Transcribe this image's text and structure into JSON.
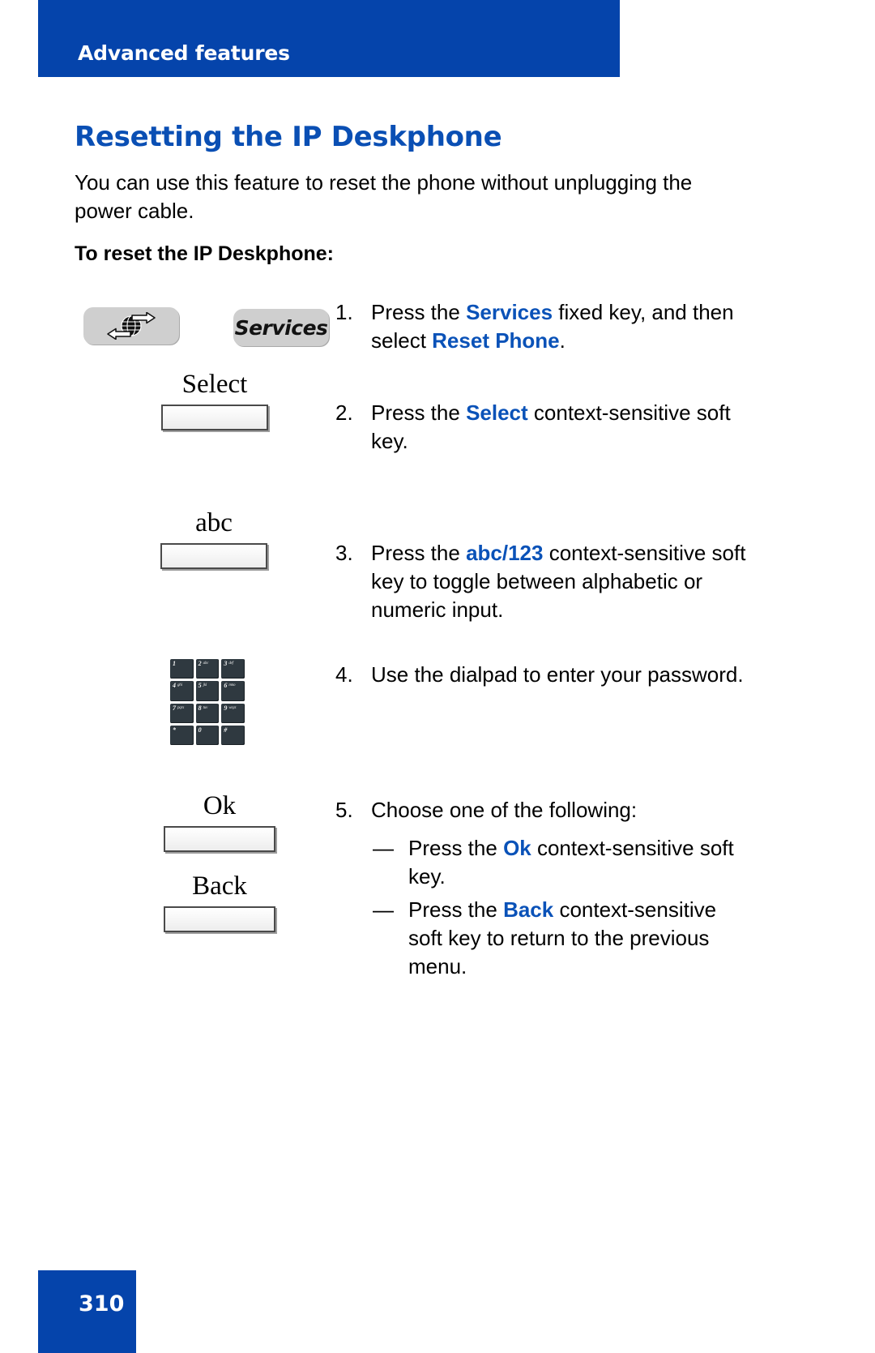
{
  "header": {
    "running_title": "Advanced features"
  },
  "page": {
    "heading": "Resetting the IP Deskphone",
    "intro": "You can use this feature to reset the phone without unplugging the power cable.",
    "subheading": "To reset the IP Deskphone:",
    "page_number": "310"
  },
  "keys": {
    "globe_icon": "globe-arrows-icon",
    "services_label": "Services"
  },
  "softkeys": [
    {
      "id": "select",
      "label": "Select"
    },
    {
      "id": "abc",
      "label": "abc"
    },
    {
      "id": "ok",
      "label": "Ok"
    },
    {
      "id": "back",
      "label": "Back"
    }
  ],
  "dialpad": {
    "keys": [
      {
        "digit": "1",
        "letters": ""
      },
      {
        "digit": "2",
        "letters": "abc"
      },
      {
        "digit": "3",
        "letters": "def"
      },
      {
        "digit": "4",
        "letters": "ghi"
      },
      {
        "digit": "5",
        "letters": "jkl"
      },
      {
        "digit": "6",
        "letters": "mno"
      },
      {
        "digit": "7",
        "letters": "pqrs"
      },
      {
        "digit": "8",
        "letters": "tuv"
      },
      {
        "digit": "9",
        "letters": "wxyz"
      },
      {
        "digit": "*",
        "letters": ""
      },
      {
        "digit": "0",
        "letters": ""
      },
      {
        "digit": "#",
        "letters": ""
      }
    ]
  },
  "steps": {
    "s1": {
      "num": "1.",
      "part_a": "Press the ",
      "bold_a": "Services",
      "part_b": " fixed key, and then select ",
      "bold_b": "Reset Phone",
      "part_c": "."
    },
    "s2": {
      "num": "2.",
      "part_a": "Press the ",
      "bold_a": "Select",
      "part_b": " context-sensitive soft key."
    },
    "s3": {
      "num": "3.",
      "part_a": "Press the ",
      "bold_a": "abc/123",
      "part_b": " context-sensitive soft key to toggle between alphabetic or numeric input."
    },
    "s4": {
      "num": "4.",
      "part_a": "Use the dialpad to enter your password."
    },
    "s5": {
      "num": "5.",
      "part_a": "Choose one of the following:"
    },
    "s5a": {
      "dash": "—",
      "part_a": "Press the ",
      "bold_a": "Ok",
      "part_b": " context-sensitive soft key."
    },
    "s5b": {
      "dash": "—",
      "part_a": "Press the ",
      "bold_a": "Back",
      "part_b": " context-sensitive soft key to return to the previous menu."
    }
  },
  "colors": {
    "brand_blue": "#0544ab",
    "heading_blue": "#0a4fb4",
    "accent_blue": "#0a52b8"
  }
}
